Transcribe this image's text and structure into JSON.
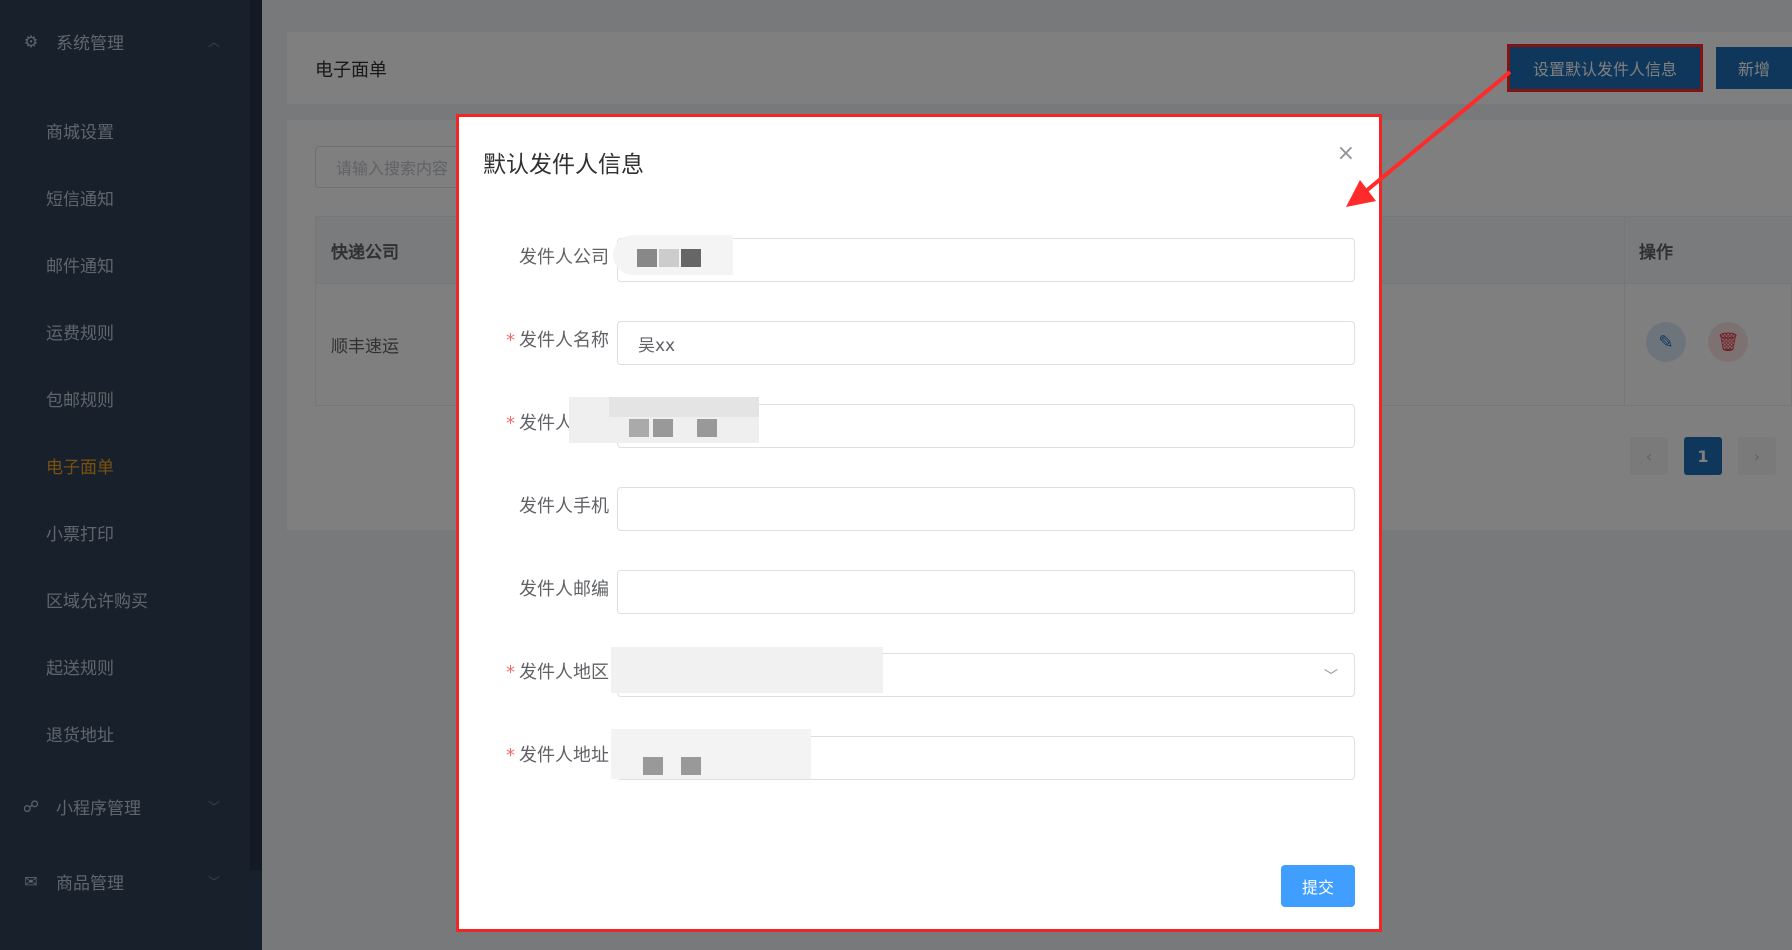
{
  "sidebar": {
    "groups": [
      {
        "label": "系统管理",
        "icon": "gear-icon",
        "expanded": true
      },
      {
        "label": "小程序管理",
        "icon": "link-icon",
        "expanded": false
      },
      {
        "label": "商品管理",
        "icon": "mail-icon",
        "expanded": false
      }
    ],
    "items": [
      {
        "label": "商城设置",
        "active": false
      },
      {
        "label": "短信通知",
        "active": false
      },
      {
        "label": "邮件通知",
        "active": false
      },
      {
        "label": "运费规则",
        "active": false
      },
      {
        "label": "包邮规则",
        "active": false
      },
      {
        "label": "电子面单",
        "active": true
      },
      {
        "label": "小票打印",
        "active": false
      },
      {
        "label": "区域允许购买",
        "active": false
      },
      {
        "label": "起送规则",
        "active": false
      },
      {
        "label": "退货地址",
        "active": false
      }
    ]
  },
  "header": {
    "title": "电子面单",
    "default_sender_button": "设置默认发件人信息",
    "add_button": "新增"
  },
  "list": {
    "search_placeholder": "请输入搜索内容",
    "columns": [
      "快递公司",
      "操作"
    ],
    "rows": [
      {
        "company": "顺丰速运"
      }
    ]
  },
  "pagination": {
    "current_page": "1",
    "prev_icon": "‹",
    "next_icon": "›"
  },
  "dialog": {
    "title": "默认发件人信息",
    "close_icon": "×",
    "fields": [
      {
        "label": "发件人公司",
        "required": false,
        "value": ""
      },
      {
        "label": "发件人名称",
        "required": true,
        "value": "吴xx"
      },
      {
        "label": "发件人电话",
        "required": true,
        "value": ""
      },
      {
        "label": "发件人手机",
        "required": false,
        "value": ""
      },
      {
        "label": "发件人邮编",
        "required": false,
        "value": ""
      },
      {
        "label": "发件人地区",
        "required": true,
        "value": ""
      },
      {
        "label": "发件人地址",
        "required": true,
        "value": ""
      }
    ],
    "required_mark": "*",
    "submit_button": "提交"
  },
  "colors": {
    "sidebar_bg": "#304156",
    "active_menu": "#f0a020",
    "primary": "#1f6fb6",
    "submit": "#409eff",
    "annotation": "#ff2a2a"
  }
}
